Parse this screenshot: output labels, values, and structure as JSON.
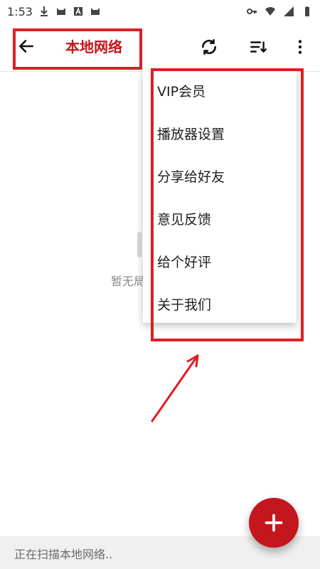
{
  "status_bar": {
    "time": "1:53",
    "left_icons": [
      "download-icon",
      "cat-icon",
      "a-box-icon",
      "cat-icon"
    ],
    "right_icons": [
      "key-icon",
      "wifi-icon",
      "signal-icon",
      "battery-icon"
    ]
  },
  "toolbar": {
    "title": "本地网络",
    "actions": [
      "sync-icon",
      "sort-icon",
      "more-vert-icon"
    ]
  },
  "menu": {
    "items": [
      "VIP会员",
      "播放器设置",
      "分享给好友",
      "意见反馈",
      "给个好评",
      "关于我们"
    ]
  },
  "empty_state": {
    "text": "暂无局"
  },
  "bottom_status": {
    "text": "正在扫描本地网络.."
  },
  "colors": {
    "accent": "#c4161c",
    "annotation_red": "#e01d23",
    "bottom_bar_bg": "#f0f0f0"
  }
}
